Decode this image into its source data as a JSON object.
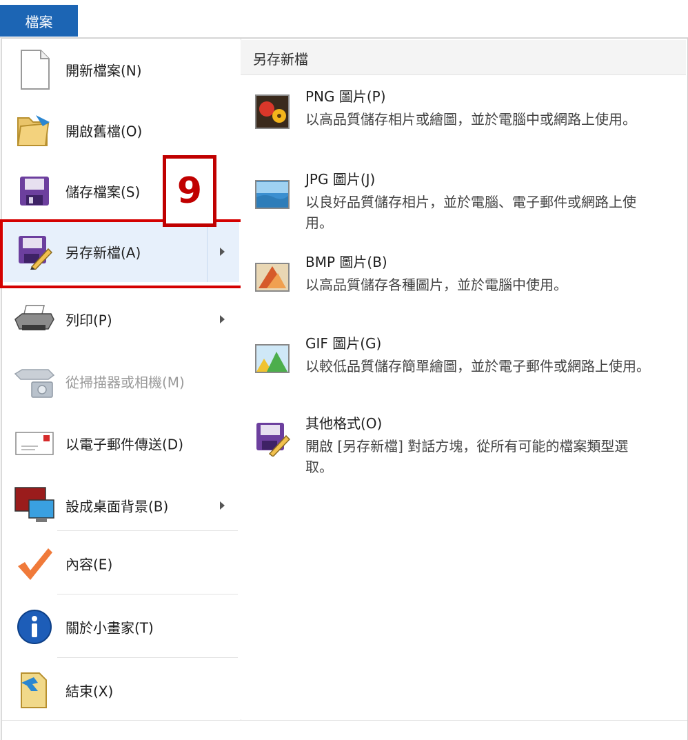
{
  "file_tab": "檔案",
  "badge": "9",
  "menu": [
    {
      "icon": "new-file-icon",
      "label": "開新檔案(N)",
      "arrow": false,
      "disabled": false,
      "selected": false
    },
    {
      "icon": "open-folder-icon",
      "label": "開啟舊檔(O)",
      "arrow": false,
      "disabled": false,
      "selected": false
    },
    {
      "icon": "save-disk-icon",
      "label": "儲存檔案(S)",
      "arrow": false,
      "disabled": false,
      "selected": false
    },
    {
      "icon": "save-as-icon",
      "label": "另存新檔(A)",
      "arrow": true,
      "disabled": false,
      "selected": true
    },
    {
      "icon": "printer-icon",
      "label": "列印(P)",
      "arrow": true,
      "disabled": false,
      "selected": false
    },
    {
      "icon": "scanner-camera-icon",
      "label": "從掃描器或相機(M)",
      "arrow": false,
      "disabled": true,
      "selected": false
    },
    {
      "icon": "email-icon",
      "label": "以電子郵件傳送(D)",
      "arrow": false,
      "disabled": false,
      "selected": false
    },
    {
      "icon": "desktop-background-icon",
      "label": "設成桌面背景(B)",
      "arrow": true,
      "disabled": false,
      "selected": false
    },
    {
      "icon": "checkmark-icon",
      "label": "內容(E)",
      "arrow": false,
      "disabled": false,
      "selected": false
    },
    {
      "icon": "info-icon",
      "label": "關於小畫家(T)",
      "arrow": false,
      "disabled": false,
      "selected": false
    },
    {
      "icon": "exit-icon",
      "label": "結束(X)",
      "arrow": false,
      "disabled": false,
      "selected": false
    }
  ],
  "submenu": {
    "header": "另存新檔",
    "items": [
      {
        "icon": "png-image-icon",
        "title": "PNG 圖片(P)",
        "desc": "以高品質儲存相片或繪圖，並於電腦中或網路上使用。"
      },
      {
        "icon": "jpg-image-icon",
        "title": "JPG 圖片(J)",
        "desc": "以良好品質儲存相片，並於電腦、電子郵件或網路上使用。"
      },
      {
        "icon": "bmp-image-icon",
        "title": "BMP 圖片(B)",
        "desc": "以高品質儲存各種圖片，並於電腦中使用。"
      },
      {
        "icon": "gif-image-icon",
        "title": "GIF 圖片(G)",
        "desc": "以較低品質儲存簡單繪圖，並於電子郵件或網路上使用。"
      },
      {
        "icon": "other-formats-icon",
        "title": "其他格式(O)",
        "desc": "開啟 [另存新檔] 對話方塊，從所有可能的檔案類型選取。"
      }
    ]
  }
}
